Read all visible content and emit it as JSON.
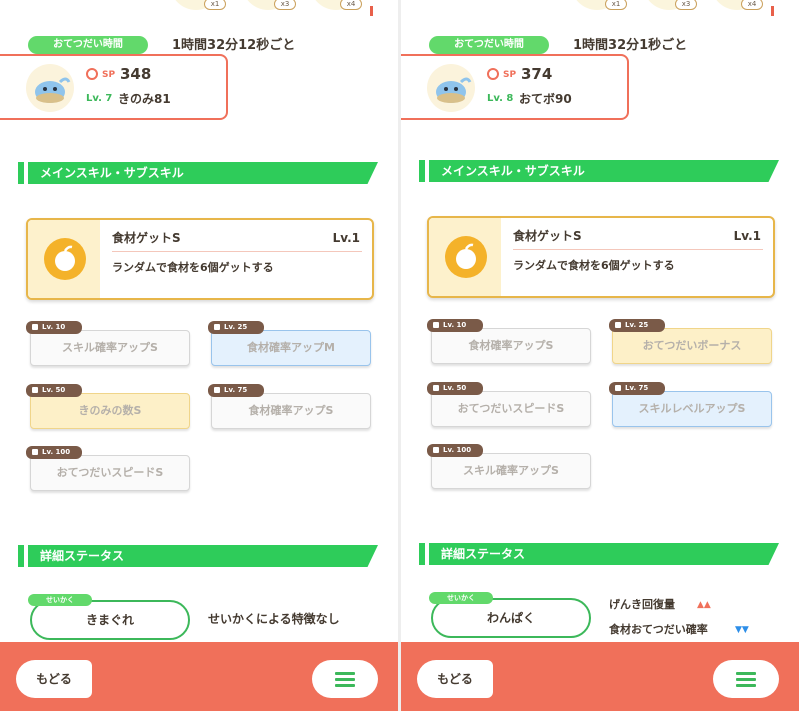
{
  "panels": [
    {
      "ingredient_counts": [
        "x1",
        "x3",
        "x4"
      ],
      "helper_label": "おてつだい時間",
      "helper_time": "1時間32分12秒ごと",
      "stats": {
        "sp_label": "SP",
        "sp_value": "348",
        "level": "Lv. 7",
        "item": "きのみ81"
      },
      "skills_header": "メインスキル・サブスキル",
      "main_skill": {
        "name": "食材ゲットS",
        "level": "Lv.1",
        "description": "ランダムで食材を6個ゲットする"
      },
      "sub_skills": [
        {
          "unlock": "Lv. 10",
          "name": "スキル確率アップS",
          "color": "gray"
        },
        {
          "unlock": "Lv. 25",
          "name": "食材確率アップM",
          "color": "blue"
        },
        {
          "unlock": "Lv. 50",
          "name": "きのみの数S",
          "color": "yellow"
        },
        {
          "unlock": "Lv. 75",
          "name": "食材確率アップS",
          "color": "gray"
        },
        {
          "unlock": "Lv. 100",
          "name": "おてつだいスピードS",
          "color": "gray"
        }
      ],
      "details_header": "詳細ステータス",
      "nature": {
        "tag": "せいかく",
        "name": "きまぐれ",
        "effect": "せいかくによる特徴なし"
      },
      "nav": {
        "back": "もどる"
      }
    },
    {
      "ingredient_counts": [
        "x1",
        "x3",
        "x4"
      ],
      "helper_label": "おてつだい時間",
      "helper_time": "1時間32分1秒ごと",
      "stats": {
        "sp_label": "SP",
        "sp_value": "374",
        "level": "Lv. 8",
        "item": "おてボ90"
      },
      "skills_header": "メインスキル・サブスキル",
      "main_skill": {
        "name": "食材ゲットS",
        "level": "Lv.1",
        "description": "ランダムで食材を6個ゲットする"
      },
      "sub_skills": [
        {
          "unlock": "Lv. 10",
          "name": "食材確率アップS",
          "color": "gray"
        },
        {
          "unlock": "Lv. 25",
          "name": "おてつだいボーナス",
          "color": "yellow"
        },
        {
          "unlock": "Lv. 50",
          "name": "おてつだいスピードS",
          "color": "gray"
        },
        {
          "unlock": "Lv. 75",
          "name": "スキルレベルアップS",
          "color": "blue"
        },
        {
          "unlock": "Lv. 100",
          "name": "スキル確率アップS",
          "color": "gray"
        }
      ],
      "details_header": "詳細ステータス",
      "nature": {
        "tag": "せいかく",
        "name": "わんぱく",
        "effects": [
          {
            "label": "げんき回復量",
            "arrows": "▲▲",
            "direction": "up"
          },
          {
            "label": "食材おてつだい確率",
            "arrows": "▼▼",
            "direction": "down"
          }
        ]
      },
      "nav": {
        "back": "もどる"
      }
    }
  ],
  "colors": {
    "accent_green": "#2ecc5a",
    "accent_coral": "#f0705a",
    "gold_border": "#e7b64a",
    "stat_up": "#f0705a",
    "stat_down": "#2d8ee8"
  },
  "icons": [
    "sp-icon",
    "apple-icon",
    "lock-icon",
    "menu-icon",
    "pokemon-avatar",
    "ingredient-icon"
  ]
}
